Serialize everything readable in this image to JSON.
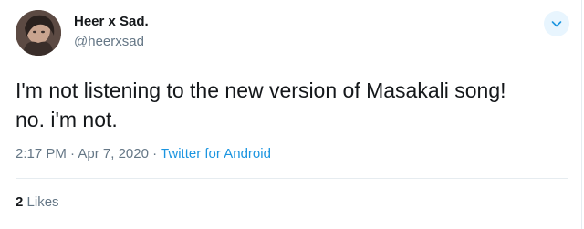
{
  "tweet": {
    "display_name": "Heer x Sad.",
    "handle": "@heerxsad",
    "text_line1": "I'm not listening to the new version of Masakali song!",
    "text_line2": "no. i'm not.",
    "time": "2:17 PM",
    "separator": "·",
    "date": "Apr 7, 2020",
    "source": "Twitter for Android",
    "likes_count": "2",
    "likes_label": "Likes"
  },
  "icons": {
    "caret": "chevron-down-icon",
    "avatar": "avatar-photo"
  },
  "colors": {
    "accent": "#1b95e0",
    "secondary_text": "#657786",
    "primary_text": "#14171a",
    "caret_bg": "#e8f5fe",
    "divider": "#e6ecf0"
  }
}
